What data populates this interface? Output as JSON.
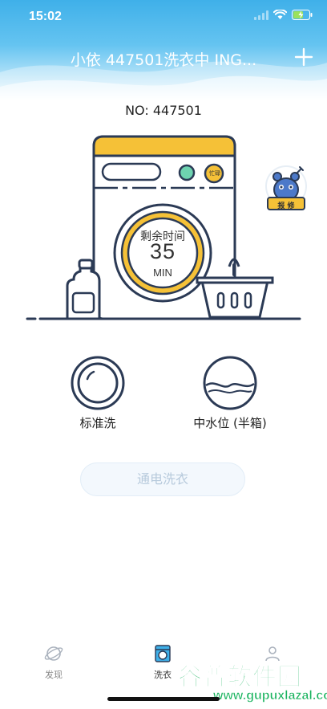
{
  "status_bar": {
    "time": "15:02"
  },
  "header": {
    "title": "小依 447501洗衣中 ING..."
  },
  "device": {
    "number_label": "NO: 447501"
  },
  "washer": {
    "remaining_label": "剩余时间",
    "remaining_value": "35",
    "remaining_unit": "MIN",
    "busy_label": "忙碌",
    "repair_label": "报 修"
  },
  "modes": {
    "wash_mode": "标准洗",
    "water_level": "中水位 (半箱)"
  },
  "actions": {
    "power_wash_label": "通电洗衣"
  },
  "tabbar": {
    "items": [
      {
        "label": "发现",
        "icon": "planet-icon"
      },
      {
        "label": "洗衣",
        "icon": "washer-icon"
      },
      {
        "label": "",
        "icon": "user-icon"
      }
    ]
  },
  "watermark": {
    "main": "谷普软件园",
    "sub": "www.gupuxlazal.com"
  },
  "colors": {
    "accent": "#f5c137",
    "primary_blue": "#3fb0e9",
    "outline": "#2b3a55"
  }
}
